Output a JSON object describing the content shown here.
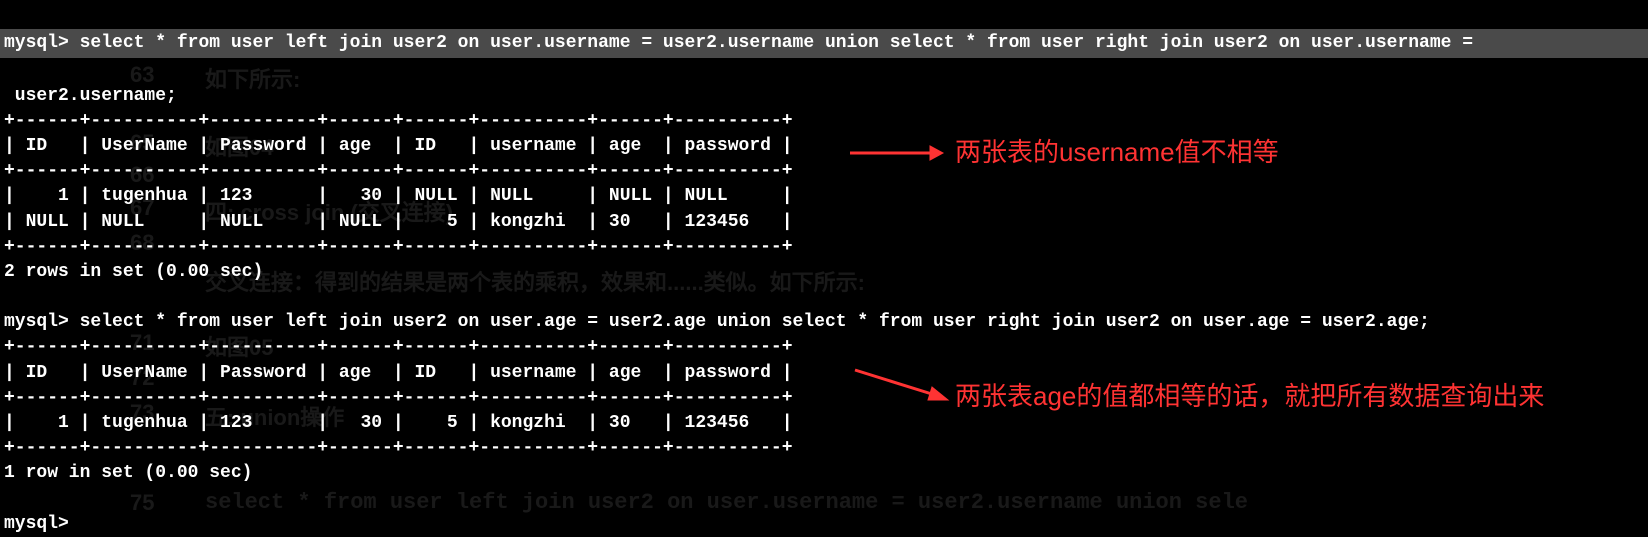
{
  "prompt1": "mysql>",
  "query1": "select * from user left join user2 on user.username = user2.username union select * from user right join user2 on user.username =",
  "query1_cont": " user2.username;",
  "divider": "+------+----------+----------+------+------+----------+------+----------+",
  "header": "| ID   | UserName | Password | age  | ID   | username | age  | password |",
  "row1": "|    1 | tugenhua | 123      |   30 | NULL | NULL     | NULL | NULL     |",
  "row2": "| NULL | NULL     | NULL     | NULL |    5 | kongzhi  | 30   | 123456   |",
  "result1_summary": "2 rows in set (0.00 sec)",
  "prompt2": "mysql>",
  "query2": "select * from user left join user2 on user.age = user2.age union select * from user right join user2 on user.age = user2.age;",
  "row3": "|    1 | tugenhua | 123      |   30 |    5 | kongzhi  | 30   | 123456   |",
  "result2_summary": "1 row in set (0.00 sec)",
  "prompt3": "mysql>",
  "annotation1": "两张表的username值不相等",
  "annotation2": "两张表age的值都相等的话，就把所有数据查询出来",
  "ghost_texts": {
    "g1": "如下所示:",
    "g2": "如图04",
    "g3": "四: cross join (交叉连接)",
    "g4": "交叉连接：得到的结果是两个表的乘积，效果和......类似。如下所示:",
    "g5": "如图05",
    "g6": "五: union操作",
    "g7": "select * from user left join user2 on user.username = user2.username union sele"
  },
  "ghost_nums": {
    "n1": "63",
    "n2": "65",
    "n3": "66",
    "n4": "67",
    "n5": "68",
    "n6": "71",
    "n7": "72",
    "n8": "73",
    "n9": "75"
  }
}
